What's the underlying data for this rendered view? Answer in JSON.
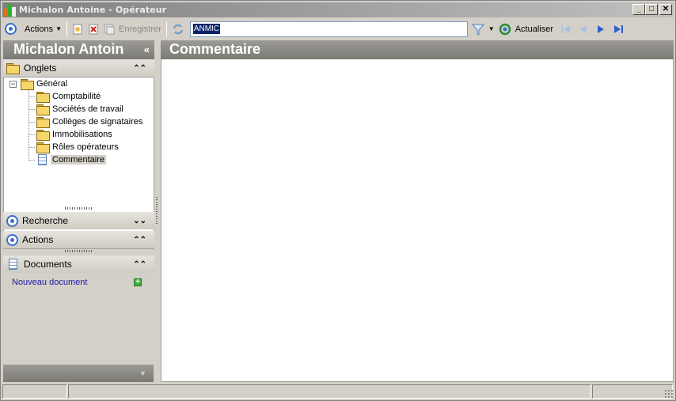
{
  "window": {
    "title": "Michalon Antoine - Opérateur",
    "controls": {
      "minimize": "_",
      "maximize": "□",
      "close": "✕"
    }
  },
  "toolbar": {
    "actions_label": "Actions",
    "save_label": "Enregistrer",
    "search_value": "ANMIC",
    "refresh_label": "Actualiser"
  },
  "left_panel": {
    "name": "Michalon Antoin",
    "collapse_glyph": "«",
    "onglets_label": "Onglets",
    "tree": {
      "root": "Général",
      "items": [
        "Comptabilité",
        "Sociétés de travail",
        "Collèges de signataires",
        "Immobilisations",
        "Rôles opérateurs",
        "Commentaire"
      ]
    },
    "recherche_label": "Recherche",
    "actions_label": "Actions",
    "documents_label": "Documents",
    "new_document_label": "Nouveau document"
  },
  "main": {
    "title": "Commentaire"
  },
  "colors": {
    "header_gray": "#8c8a84",
    "accent_blue": "#3a6fc9",
    "link_blue": "#1a1aa8"
  }
}
